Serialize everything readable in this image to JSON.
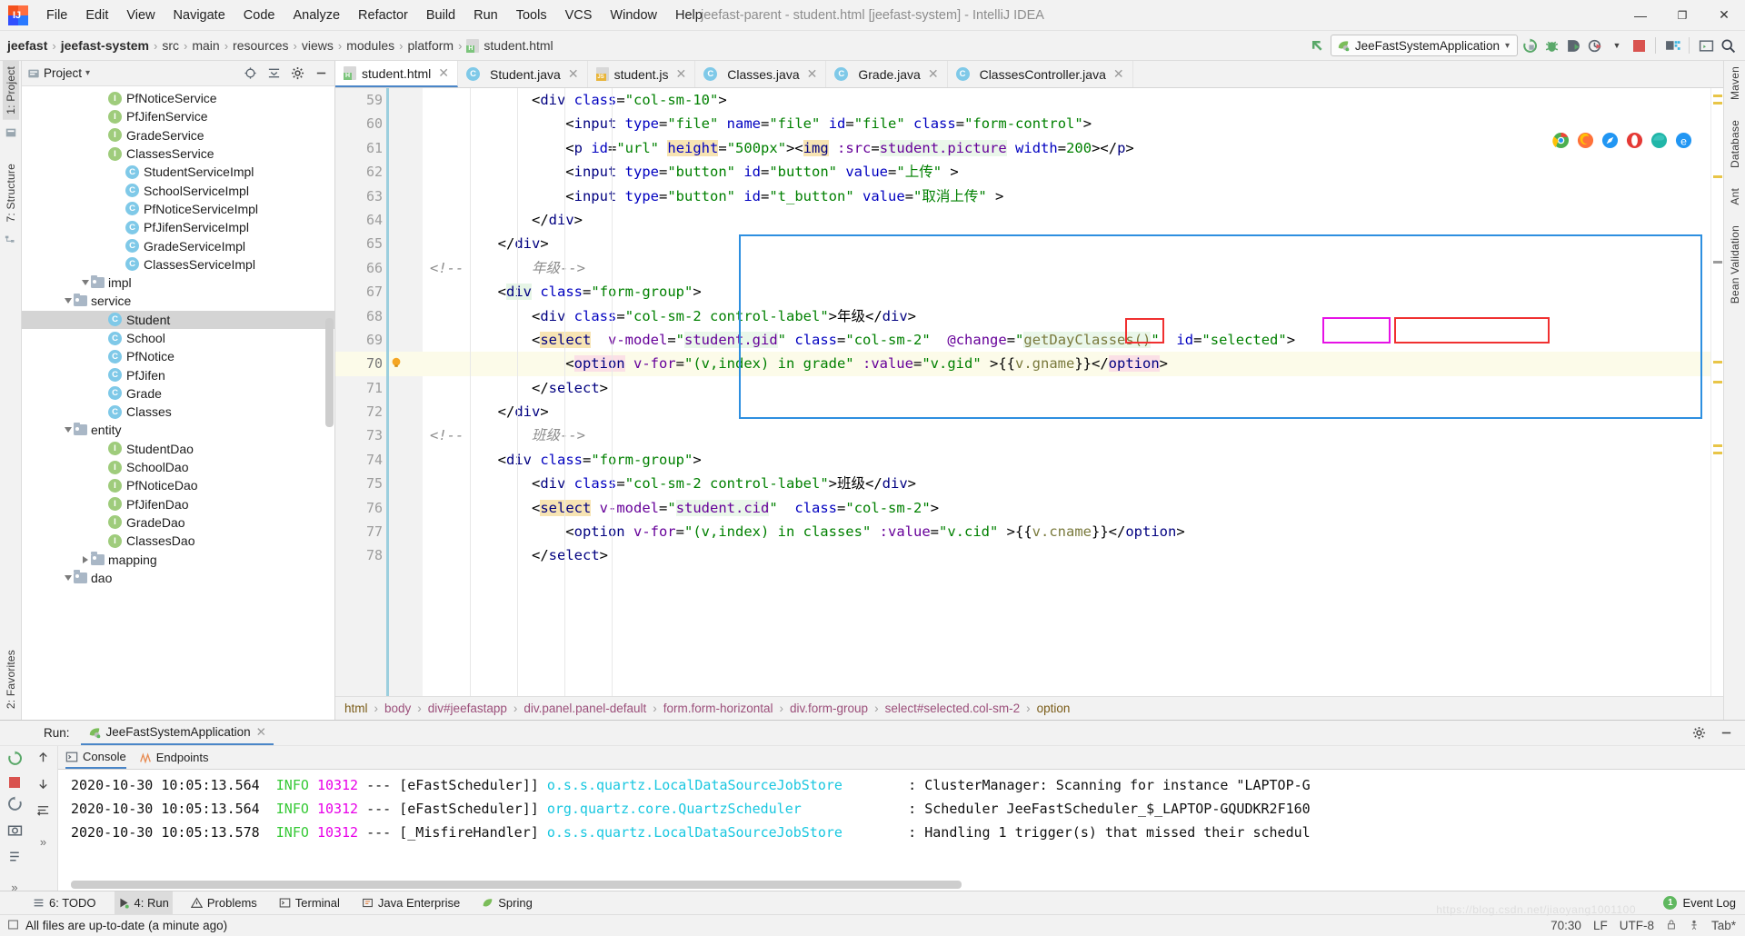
{
  "window": {
    "title": "jeefast-parent - student.html [jeefast-system] - IntelliJ IDEA",
    "logo_text": "IJ",
    "minimize": "—",
    "maximize": "❐",
    "close": "✕"
  },
  "menu": [
    {
      "label": "File"
    },
    {
      "label": "Edit"
    },
    {
      "label": "View"
    },
    {
      "label": "Navigate"
    },
    {
      "label": "Code"
    },
    {
      "label": "Analyze"
    },
    {
      "label": "Refactor"
    },
    {
      "label": "Build"
    },
    {
      "label": "Run"
    },
    {
      "label": "Tools"
    },
    {
      "label": "VCS"
    },
    {
      "label": "Window"
    },
    {
      "label": "Help"
    }
  ],
  "breadcrumb": {
    "items": [
      "jeefast",
      "jeefast-system",
      "src",
      "main",
      "resources",
      "views",
      "modules",
      "platform",
      "student.html"
    ],
    "separator": "›"
  },
  "toolbar": {
    "run_config": "JeeFastSystemApplication",
    "run_config_caret": "▾",
    "icons": [
      "back-arrow-icon",
      "rerun-icon",
      "debug-icon",
      "coverage-icon",
      "profiler-icon",
      "stop-icon",
      "project-structure-icon",
      "terminal-icon",
      "search-everywhere-icon"
    ]
  },
  "project_pane": {
    "title": "Project",
    "caret": "▾",
    "tools": [
      "locate-icon",
      "collapse-all-icon",
      "settings-icon",
      "hide-icon"
    ],
    "tree": [
      {
        "label": "dao",
        "indent": 2,
        "kind": "folder",
        "twist": "down"
      },
      {
        "label": "mapping",
        "indent": 3,
        "kind": "folder",
        "twist": "right"
      },
      {
        "label": "ClassesDao",
        "indent": 4,
        "kind": "I"
      },
      {
        "label": "GradeDao",
        "indent": 4,
        "kind": "I"
      },
      {
        "label": "PfJifenDao",
        "indent": 4,
        "kind": "I"
      },
      {
        "label": "PfNoticeDao",
        "indent": 4,
        "kind": "I"
      },
      {
        "label": "SchoolDao",
        "indent": 4,
        "kind": "I"
      },
      {
        "label": "StudentDao",
        "indent": 4,
        "kind": "I"
      },
      {
        "label": "entity",
        "indent": 2,
        "kind": "folder",
        "twist": "down"
      },
      {
        "label": "Classes",
        "indent": 4,
        "kind": "C"
      },
      {
        "label": "Grade",
        "indent": 4,
        "kind": "C"
      },
      {
        "label": "PfJifen",
        "indent": 4,
        "kind": "C"
      },
      {
        "label": "PfNotice",
        "indent": 4,
        "kind": "C"
      },
      {
        "label": "School",
        "indent": 4,
        "kind": "C"
      },
      {
        "label": "Student",
        "indent": 4,
        "kind": "C",
        "selected": true
      },
      {
        "label": "service",
        "indent": 2,
        "kind": "folder",
        "twist": "down"
      },
      {
        "label": "impl",
        "indent": 3,
        "kind": "folder",
        "twist": "down"
      },
      {
        "label": "ClassesServiceImpl",
        "indent": 5,
        "kind": "C"
      },
      {
        "label": "GradeServiceImpl",
        "indent": 5,
        "kind": "C"
      },
      {
        "label": "PfJifenServiceImpl",
        "indent": 5,
        "kind": "C"
      },
      {
        "label": "PfNoticeServiceImpl",
        "indent": 5,
        "kind": "C"
      },
      {
        "label": "SchoolServiceImpl",
        "indent": 5,
        "kind": "C"
      },
      {
        "label": "StudentServiceImpl",
        "indent": 5,
        "kind": "C"
      },
      {
        "label": "ClassesService",
        "indent": 4,
        "kind": "I"
      },
      {
        "label": "GradeService",
        "indent": 4,
        "kind": "I"
      },
      {
        "label": "PfJifenService",
        "indent": 4,
        "kind": "I"
      },
      {
        "label": "PfNoticeService",
        "indent": 4,
        "kind": "I"
      }
    ]
  },
  "left_rail": {
    "tabs": [
      "1: Project",
      "7: Structure"
    ],
    "icons": [
      "module-icon",
      "favorites-icon"
    ]
  },
  "right_rail": {
    "tabs": [
      "Maven",
      "Database",
      "Ant",
      "Bean Validation"
    ]
  },
  "editor_tabs": [
    {
      "label": "student.html",
      "icon": "html-file-icon",
      "active": true
    },
    {
      "label": "Student.java",
      "icon": "java-class-icon",
      "active": false
    },
    {
      "label": "student.js",
      "icon": "js-file-icon",
      "active": false
    },
    {
      "label": "Classes.java",
      "icon": "java-class-icon",
      "active": false
    },
    {
      "label": "Grade.java",
      "icon": "java-class-icon",
      "active": false
    },
    {
      "label": "ClassesController.java",
      "icon": "java-class-icon",
      "active": false
    }
  ],
  "editor": {
    "first_line": 59,
    "current_line": 70,
    "lines": [
      {
        "n": 59,
        "html": "<span class=\"t-punc\">            &lt;</span><span class=\"t-tag\">div</span> <span class=\"t-attr\">class</span><span class=\"t-punc\">=</span><span class=\"t-val\">\"col-sm-10\"</span><span class=\"t-punc\">&gt;</span>"
      },
      {
        "n": 60,
        "html": "<span class=\"t-punc\">                &lt;</span><span class=\"t-tag\">input</span> <span class=\"t-attr\">type</span><span class=\"t-punc\">=</span><span class=\"t-val\">\"file\"</span> <span class=\"t-attr\">name</span><span class=\"t-punc\">=</span><span class=\"t-val\">\"file\"</span> <span class=\"t-attr\">id</span><span class=\"t-punc\">=</span><span class=\"t-val\">\"file\"</span> <span class=\"t-attr\">class</span><span class=\"t-punc\">=</span><span class=\"t-val\">\"form-control\"</span><span class=\"t-punc\">&gt;</span>"
      },
      {
        "n": 61,
        "html": "<span class=\"t-punc\">                &lt;</span><span class=\"t-tag\">p</span> <span class=\"t-attr\">id</span><span class=\"t-punc\">=</span><span class=\"t-val\">\"url\"</span> <span class=\"hl-yellow\"><span class=\"t-attr\">height</span></span><span class=\"t-punc\">=</span><span class=\"t-val\">\"500px\"</span><span class=\"t-punc\">&gt;&lt;</span><span class=\"hl-yellow t-tag\">img</span> <span class=\"t-expr\">:src</span><span class=\"t-punc\">=</span><span class=\"hl-lgreen t-expr\">student.picture</span> <span class=\"t-attr\">width</span><span class=\"t-punc\">=</span><span class=\"t-val\">200</span><span class=\"t-punc\">&gt;&lt;/</span><span class=\"t-tag\">p</span><span class=\"t-punc\">&gt;</span>"
      },
      {
        "n": 62,
        "html": "<span class=\"t-punc\">                &lt;</span><span class=\"t-tag\">input</span> <span class=\"t-attr\">type</span><span class=\"t-punc\">=</span><span class=\"t-val\">\"button\"</span> <span class=\"t-attr\">id</span><span class=\"t-punc\">=</span><span class=\"t-val\">\"button\"</span> <span class=\"t-attr\">value</span><span class=\"t-punc\">=</span><span class=\"t-val\">\"上传\"</span> <span class=\"t-punc\">&gt;</span>"
      },
      {
        "n": 63,
        "html": "<span class=\"t-punc\">                &lt;</span><span class=\"t-tag\">input</span> <span class=\"t-attr\">type</span><span class=\"t-punc\">=</span><span class=\"t-val\">\"button\"</span> <span class=\"t-attr\">id</span><span class=\"t-punc\">=</span><span class=\"t-val\">\"t_button\"</span> <span class=\"t-attr\">value</span><span class=\"t-punc\">=</span><span class=\"t-val\">\"取消上传\"</span> <span class=\"t-punc\">&gt;</span>"
      },
      {
        "n": 64,
        "html": "<span class=\"t-punc\">            &lt;/</span><span class=\"t-tag\">div</span><span class=\"t-punc\">&gt;</span>"
      },
      {
        "n": 65,
        "html": "<span class=\"t-punc\">        &lt;/</span><span class=\"t-tag\">div</span><span class=\"t-punc\">&gt;</span>"
      },
      {
        "n": 66,
        "html": "<span class=\"t-cmt\">&lt;!--        年级--&gt;</span>"
      },
      {
        "n": 67,
        "html": "<span class=\"t-punc\">        &lt;</span><span class=\"hl-green t-tag\">div</span> <span class=\"t-attr\">class</span><span class=\"t-punc\">=</span><span class=\"t-val\">\"form-group\"</span><span class=\"t-punc\">&gt;</span>"
      },
      {
        "n": 68,
        "html": "<span class=\"t-punc\">            &lt;</span><span class=\"t-tag\">div</span> <span class=\"t-attr\">class</span><span class=\"t-punc\">=</span><span class=\"t-val\">\"col-sm-2 control-label\"</span><span class=\"t-punc\">&gt;年级&lt;/</span><span class=\"t-tag\">div</span><span class=\"t-punc\">&gt;</span>"
      },
      {
        "n": 69,
        "html": "<span class=\"t-punc\">            &lt;</span><span class=\"hl-yellow t-tag\">select</span>  <span class=\"t-expr\">v-model</span><span class=\"t-punc\">=</span><span class=\"t-val\">\"</span><span class=\"hl-lgreen t-expr\">student</span><span class=\"hl-lgreen t-expr\">.gid</span><span class=\"t-val\">\"</span> <span class=\"t-attr\">class</span><span class=\"t-punc\">=</span><span class=\"t-val\">\"col-sm-2\"</span>  <span class=\"t-expr\">@change</span><span class=\"t-punc\">=</span><span class=\"t-val\">\"</span><span class=\"hl-lgreen t-mus\">getDayClasses()</span><span class=\"t-val\">\"</span>  <span class=\"t-attr\">id</span><span class=\"t-punc\">=</span><span class=\"t-val\">\"selected\"</span><span class=\"t-punc\">&gt;</span>"
      },
      {
        "n": 70,
        "html": "<span class=\"t-punc\">                &lt;</span><span class=\"hl-pink t-tag\">option</span> <span class=\"t-expr\">v-for</span><span class=\"t-punc\">=</span><span class=\"t-val\">\"(v,index) in grade\"</span> <span class=\"t-expr\">:value</span><span class=\"t-punc\">=</span><span class=\"t-val\">\"v.gid\"</span> <span class=\"t-punc\">&gt;{{</span><span class=\"t-mus\">v.gname</span><span class=\"t-punc\">}}&lt;/</span><span class=\"hl-pink t-tag\">option</span><span class=\"t-punc\">&gt;</span>"
      },
      {
        "n": 71,
        "html": "<span class=\"t-punc\">            &lt;/</span><span class=\"t-tag\">select</span><span class=\"t-punc\">&gt;</span>"
      },
      {
        "n": 72,
        "html": "<span class=\"t-punc\">        &lt;/</span><span class=\"t-tag\">div</span><span class=\"t-punc\">&gt;</span>"
      },
      {
        "n": 73,
        "html": "<span class=\"t-cmt\">&lt;!--        班级--&gt;</span>"
      },
      {
        "n": 74,
        "html": "<span class=\"t-punc\">        &lt;</span><span class=\"t-tag\">div</span> <span class=\"t-attr\">class</span><span class=\"t-punc\">=</span><span class=\"t-val\">\"form-group\"</span><span class=\"t-punc\">&gt;</span>"
      },
      {
        "n": 75,
        "html": "<span class=\"t-punc\">            &lt;</span><span class=\"t-tag\">div</span> <span class=\"t-attr\">class</span><span class=\"t-punc\">=</span><span class=\"t-val\">\"col-sm-2 control-label\"</span><span class=\"t-punc\">&gt;班级&lt;/</span><span class=\"t-tag\">div</span><span class=\"t-punc\">&gt;</span>"
      },
      {
        "n": 76,
        "html": "<span class=\"t-punc\">            &lt;</span><span class=\"hl-yellow t-tag\">select</span> <span class=\"t-expr\">v-model</span><span class=\"t-punc\">=</span><span class=\"t-val\">\"</span><span class=\"hl-lgreen t-expr\">student.cid</span><span class=\"t-val\">\"</span>  <span class=\"t-attr\">class</span><span class=\"t-punc\">=</span><span class=\"t-val\">\"col-sm-2\"</span><span class=\"t-punc\">&gt;</span>"
      },
      {
        "n": 77,
        "html": "<span class=\"t-punc\">                &lt;</span><span class=\"t-tag\">option</span> <span class=\"t-expr\">v-for</span><span class=\"t-punc\">=</span><span class=\"t-val\">\"(v,index) in classes\"</span> <span class=\"t-expr\">:value</span><span class=\"t-punc\">=</span><span class=\"t-val\">\"v.cid\"</span> <span class=\"t-punc\">&gt;{{</span><span class=\"t-mus\">v.cname</span><span class=\"t-punc\">}}&lt;/</span><span class=\"t-tag\">option</span><span class=\"t-punc\">&gt;</span>"
      },
      {
        "n": 78,
        "html": "<span class=\"t-punc\">            &lt;/</span><span class=\"t-tag\">select</span><span class=\"t-punc\">&gt;</span>"
      }
    ],
    "browser_icons": [
      "chrome-icon",
      "firefox-icon",
      "safari-icon",
      "opera-icon",
      "edge-icon",
      "ie-icon"
    ],
    "bulb_hint": "intention-bulb-icon"
  },
  "annotations": {
    "blue_box_label": "highlight-region-grade-select",
    "red_box_1_label": "highlight-gid-binding",
    "magenta_box_label": "highlight-change-event",
    "red_box_2_label": "highlight-getDayClasses-handler",
    "colors": {
      "blue": "#2d8fe0",
      "red": "#f03030",
      "magenta": "#e612e6"
    }
  },
  "dom_breadcrumb": {
    "items": [
      "html",
      "body",
      "div#jeefastapp",
      "div.panel.panel-default",
      "form.form-horizontal",
      "div.form-group",
      "select#selected.col-sm-2",
      "option"
    ],
    "separator": "›"
  },
  "run_panel": {
    "label": "Run:",
    "tab": "JeeFastSystemApplication",
    "tab_close": "✕",
    "console_tabs": [
      {
        "label": "Console",
        "icon": "console-icon",
        "selected": true
      },
      {
        "label": "Endpoints",
        "icon": "endpoints-icon",
        "selected": false
      }
    ],
    "toolbar_icons": [
      "rerun-icon",
      "stop-icon",
      "restart-icon",
      "screenshot-icon",
      "print-icon"
    ],
    "toolbar2_icons": [
      "up-arrow-icon",
      "down-arrow-icon",
      "soft-wrap-icon"
    ],
    "log": [
      {
        "ts": "2020-10-30 10:05:13.564",
        "level": "INFO",
        "pid": "10312",
        "dash": "---",
        "thread": "[eFastScheduler]]",
        "logger": "o.s.s.quartz.LocalDataSourceJobStore",
        "msg": ": ClusterManager: Scanning for instance \"LAPTOP-G"
      },
      {
        "ts": "2020-10-30 10:05:13.564",
        "level": "INFO",
        "pid": "10312",
        "dash": "---",
        "thread": "[eFastScheduler]]",
        "logger": "org.quartz.core.QuartzScheduler",
        "msg": ": Scheduler JeeFastScheduler_$_LAPTOP-GQUDKR2F160"
      },
      {
        "ts": "2020-10-30 10:05:13.578",
        "level": "INFO",
        "pid": "10312",
        "dash": "---",
        "thread": "[_MisfireHandler]",
        "logger": "o.s.s.quartz.LocalDataSourceJobStore",
        "msg": ": Handling 1 trigger(s) that missed their schedul"
      }
    ],
    "settings_icon": "gear-icon",
    "hide_icon": "hide-icon"
  },
  "bottom_tabs": [
    {
      "label": "6: TODO",
      "icon": "todo-icon",
      "selected": false
    },
    {
      "label": "4: Run",
      "icon": "run-icon",
      "selected": true
    },
    {
      "label": "Problems",
      "icon": "problems-icon",
      "selected": false
    },
    {
      "label": "Terminal",
      "icon": "terminal-icon",
      "selected": false
    },
    {
      "label": "Java Enterprise",
      "icon": "java-enterprise-icon",
      "selected": false
    },
    {
      "label": "Spring",
      "icon": "spring-icon",
      "selected": false
    }
  ],
  "event_log": {
    "count": "1",
    "label": "Event Log"
  },
  "status": {
    "message": "All files are up-to-date (a minute ago)",
    "caret": "70:30",
    "line_sep": "LF",
    "encoding": "UTF-8",
    "indent": "Tab*",
    "icons": [
      "lock-icon",
      "inspection-icon"
    ]
  }
}
